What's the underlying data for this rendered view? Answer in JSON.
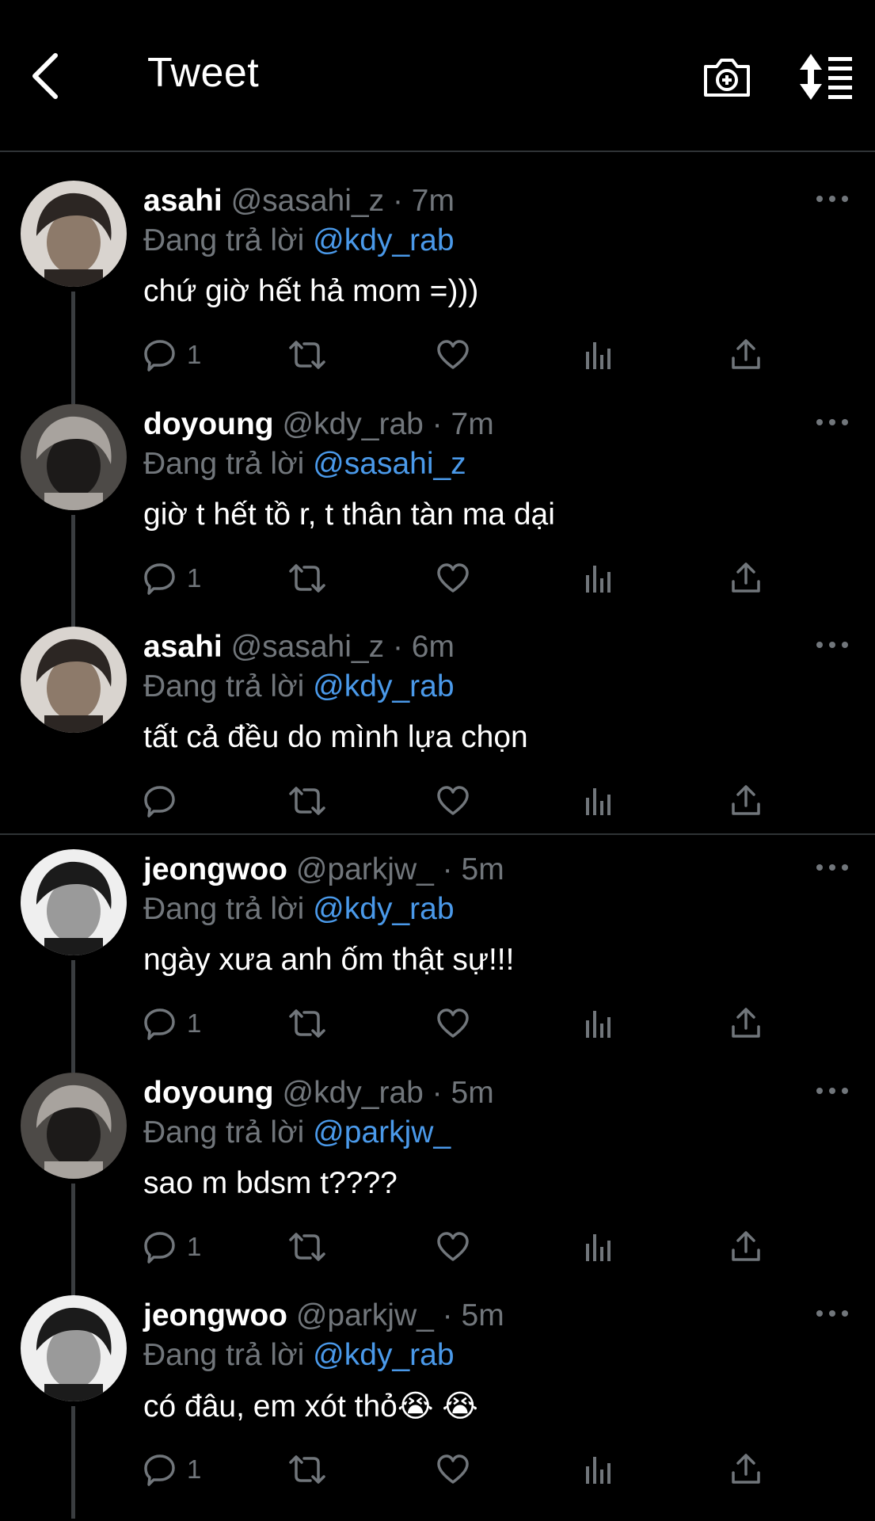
{
  "header": {
    "title": "Tweet",
    "back_icon": "chevron-left-icon",
    "camera_icon": "camera-plus-icon",
    "sort_icon": "sort-arrows-icon"
  },
  "colors": {
    "background": "#000000",
    "text": "#ffffff",
    "secondary": "#71767b",
    "accent": "#4a99e9",
    "divider": "#2f3336"
  },
  "tweets": [
    {
      "name": "asahi",
      "handle": "@sasahi_z",
      "dot": "·",
      "time": "7m",
      "replying_prefix": "Đang trả lời",
      "replying_to": "@kdy_rab",
      "text": "chứ giờ hết hả mom =)))",
      "reply_count": "1"
    },
    {
      "name": "doyoung",
      "handle": "@kdy_rab",
      "dot": "·",
      "time": "7m",
      "replying_prefix": "Đang trả lời",
      "replying_to": "@sasahi_z",
      "text": "giờ t hết tồ r, t thân tàn ma dại",
      "reply_count": "1"
    },
    {
      "name": "asahi",
      "handle": "@sasahi_z",
      "dot": "·",
      "time": "6m",
      "replying_prefix": "Đang trả lời",
      "replying_to": "@kdy_rab",
      "text": "tất cả đều do mình lựa chọn",
      "reply_count": ""
    },
    {
      "name": "jeongwoo",
      "handle": "@parkjw_",
      "dot": "·",
      "time": "5m",
      "replying_prefix": "Đang trả lời",
      "replying_to": "@kdy_rab",
      "text": "ngày xưa anh ốm thật sự!!!",
      "reply_count": "1"
    },
    {
      "name": "doyoung",
      "handle": "@kdy_rab",
      "dot": "·",
      "time": "5m",
      "replying_prefix": "Đang trả lời",
      "replying_to": "@parkjw_",
      "text": "sao m bdsm t????",
      "reply_count": "1"
    },
    {
      "name": "jeongwoo",
      "handle": "@parkjw_",
      "dot": "·",
      "time": "5m",
      "replying_prefix": "Đang trả lời",
      "replying_to": "@kdy_rab",
      "text": "có đâu, em xót thỏ😭 😭",
      "reply_count": "1"
    }
  ]
}
